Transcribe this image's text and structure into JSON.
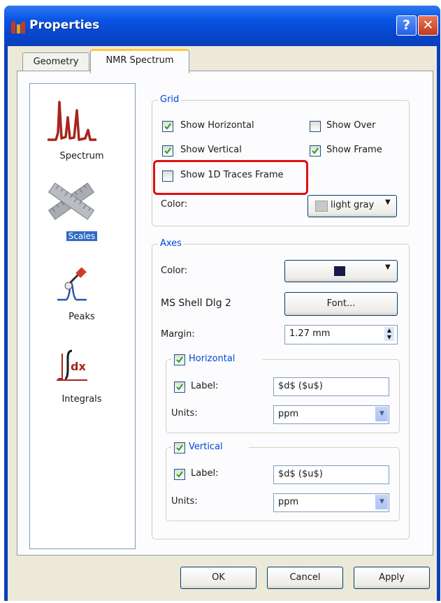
{
  "window": {
    "title": "Properties",
    "help_glyph": "?",
    "close_glyph": "✕"
  },
  "tabs": [
    {
      "label": "Geometry"
    },
    {
      "label": "NMR Spectrum"
    }
  ],
  "categories": [
    {
      "label": "Spectrum",
      "icon": "spectrum-icon"
    },
    {
      "label": "Scales",
      "icon": "scales-icon",
      "selected": true
    },
    {
      "label": "Peaks",
      "icon": "peaks-icon"
    },
    {
      "label": "Integrals",
      "icon": "integrals-icon"
    }
  ],
  "grid": {
    "title": "Grid",
    "show_horizontal": {
      "label": "Show Horizontal",
      "checked": true
    },
    "show_over": {
      "label": "Show Over",
      "checked": false
    },
    "show_vertical": {
      "label": "Show Vertical",
      "checked": true
    },
    "show_frame": {
      "label": "Show Frame",
      "checked": true
    },
    "show_1d_traces_frame": {
      "label": "Show 1D Traces Frame",
      "checked": false
    },
    "color_label": "Color:",
    "color_value": "light gray",
    "color_swatch": "#c8c8c8"
  },
  "axes": {
    "title": "Axes",
    "color_label": "Color:",
    "color_swatch": "#1a1a4a",
    "font_name": "MS Shell Dlg 2",
    "font_button": "Font...",
    "margin_label": "Margin:",
    "margin_value": "1.27 mm",
    "horizontal": {
      "title": "Horizontal",
      "checked": true,
      "label_label": "Label:",
      "label_checked": true,
      "label_value": "$d$ ($u$)",
      "units_label": "Units:",
      "units_value": "ppm"
    },
    "vertical": {
      "title": "Vertical",
      "checked": true,
      "label_label": "Label:",
      "label_checked": true,
      "label_value": "$d$ ($u$)",
      "units_label": "Units:",
      "units_value": "ppm"
    }
  },
  "buttons": {
    "ok": "OK",
    "cancel": "Cancel",
    "apply": "Apply"
  },
  "colors": {
    "title_bar": "#0a54e3",
    "highlight": "#e01010",
    "selection": "#316ac5"
  }
}
